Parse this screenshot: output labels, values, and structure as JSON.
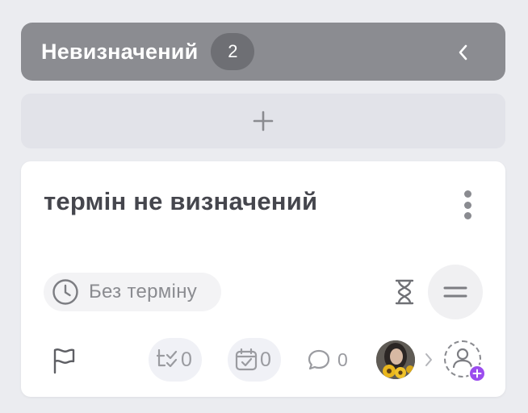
{
  "group": {
    "title": "Невизначений",
    "count": "2"
  },
  "card": {
    "title": "термін не визначений",
    "due_label": "Без терміну",
    "checklist_count": "0",
    "subtasks_count": "0",
    "comments_count": "0"
  },
  "icons": {
    "collapse": "chevron-left-icon",
    "add": "plus-icon",
    "menu": "more-vertical-icon",
    "clock": "clock-icon",
    "hourglass": "hourglass-icon",
    "priority": "equals-icon",
    "flag": "flag-icon",
    "checklist": "checklist-icon",
    "calendar": "calendar-check-icon",
    "comment": "comment-icon",
    "avatar": "user-avatar",
    "add_user": "add-user-icon"
  },
  "colors": {
    "group_header": "#8b8c91",
    "accent_add_user": "#9b4dee",
    "page_background": "#ebecf0"
  }
}
